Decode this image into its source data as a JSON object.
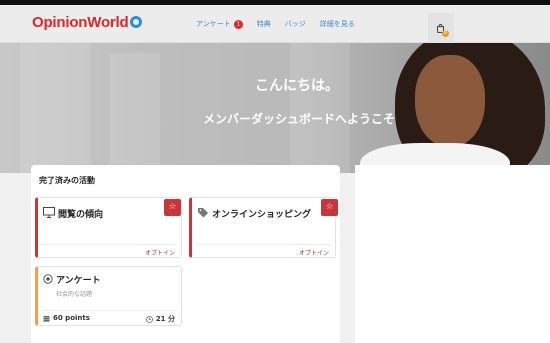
{
  "brand": {
    "name": "OpinionWorld"
  },
  "nav": {
    "items": [
      {
        "label": "アンケート",
        "badge": "1"
      },
      {
        "label": "特典"
      },
      {
        "label": "バッジ"
      },
      {
        "label": "詳細を見る"
      }
    ],
    "cart_badge": "0"
  },
  "hero": {
    "greeting": "こんにちは。",
    "welcome": "メンバーダッシュボードへようこそ"
  },
  "activity": {
    "title": "完了済みの活動",
    "cards": [
      {
        "title": "閲覧の傾向",
        "icon": "monitor-icon",
        "action": "オプトイン"
      },
      {
        "title": "オンラインショッピング",
        "icon": "tag-icon",
        "action": "オプトイン"
      },
      {
        "title": "アンケート",
        "icon": "survey-icon",
        "subtitle": "社会的な話題",
        "points": "60 points",
        "time": "21 分"
      }
    ]
  },
  "colors": {
    "brand_red": "#e0262b",
    "brand_blue": "#2b8fd6",
    "accent_orange": "#f0a045"
  }
}
